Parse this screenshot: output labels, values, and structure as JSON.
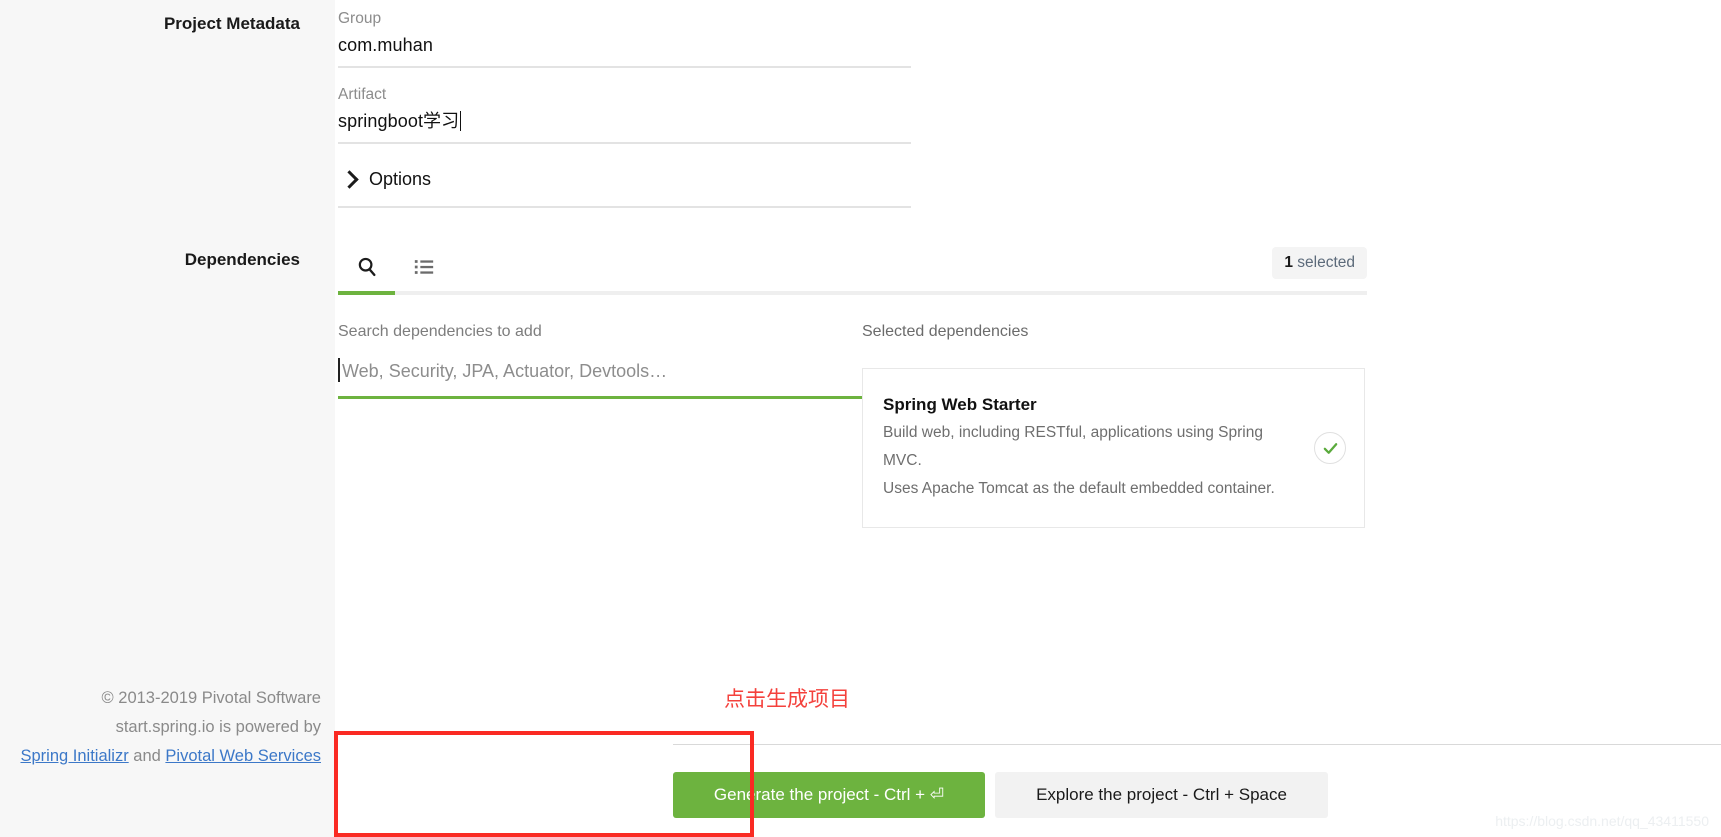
{
  "sidebar": {
    "metadata_label": "Project Metadata",
    "dependencies_label": "Dependencies",
    "footer": {
      "copyright": "© 2013-2019 Pivotal Software",
      "powered_by": "start.spring.io is powered by",
      "link_initializr": "Spring Initializr",
      "and_text": " and ",
      "link_pws": "Pivotal Web Services"
    }
  },
  "metadata": {
    "group": {
      "label": "Group",
      "value": "com.muhan"
    },
    "artifact": {
      "label": "Artifact",
      "value": "springboot学习"
    },
    "options": {
      "label": "Options",
      "icon": "chevron-right-icon"
    }
  },
  "dependencies": {
    "tabs": [
      {
        "id": "search",
        "icon": "search-icon",
        "active": true
      },
      {
        "id": "list",
        "icon": "list-icon",
        "active": false
      }
    ],
    "selected_badge": {
      "count": "1",
      "text": " selected"
    },
    "search": {
      "caption": "Search dependencies to add",
      "placeholder": "Web, Security, JPA, Actuator, Devtools…",
      "value": ""
    },
    "selected": {
      "caption": "Selected dependencies",
      "items": [
        {
          "title": "Spring Web Starter",
          "desc_line1": "Build web, including RESTful, applications using Spring MVC.",
          "desc_line2": "Uses Apache Tomcat as the default embedded container.",
          "check_icon": "check-circle-icon"
        }
      ]
    }
  },
  "annotation": {
    "text": "点击生成项目",
    "color": "#f4413c"
  },
  "actions": {
    "generate_label": "Generate the project - Ctrl + ⏎",
    "explore_label": "Explore the project - Ctrl + Space"
  },
  "watermark": "https://blog.csdn.net/qq_43411550",
  "colors": {
    "accent_green": "#6db33f",
    "annotation_red": "#fa2a23",
    "sidebar_bg": "#f7f7f7",
    "link_blue": "#3c78c8"
  }
}
